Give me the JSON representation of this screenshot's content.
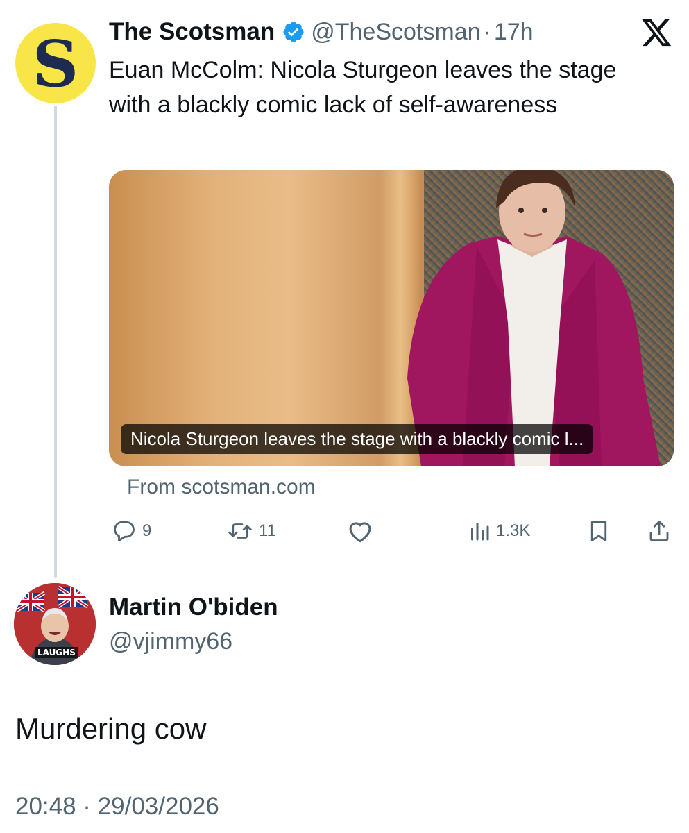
{
  "quoted_post": {
    "avatar_letter": "S",
    "display_name": "The Scotsman",
    "handle": "@TheScotsman",
    "separator": "·",
    "time": "17h",
    "text": "Euan McColm: Nicola Sturgeon leaves the stage with a blackly comic lack of self-awareness",
    "card": {
      "title": "Nicola Sturgeon leaves the stage with a blackly comic l...",
      "source": "From scotsman.com"
    },
    "stats": {
      "replies": "9",
      "reposts": "11",
      "views": "1.3K"
    }
  },
  "reply_post": {
    "display_name": "Martin O'biden",
    "handle": "@vjimmy66",
    "avatar_badge": "LAUGHS",
    "text": "Murdering cow",
    "timestamp": "20:48 · 29/03/2026"
  },
  "icons": {
    "verified": "verified-badge-icon",
    "x_logo": "x-logo-icon",
    "reply": "reply-icon",
    "repost": "repost-icon",
    "like": "heart-icon",
    "views": "views-icon",
    "bookmark": "bookmark-icon",
    "share": "share-icon"
  },
  "colors": {
    "text_primary": "#0f1419",
    "text_secondary": "#536471",
    "verified_blue": "#1d9bf0",
    "thread_line": "#cfd9de",
    "scotsman_yellow": "#f8e547"
  }
}
